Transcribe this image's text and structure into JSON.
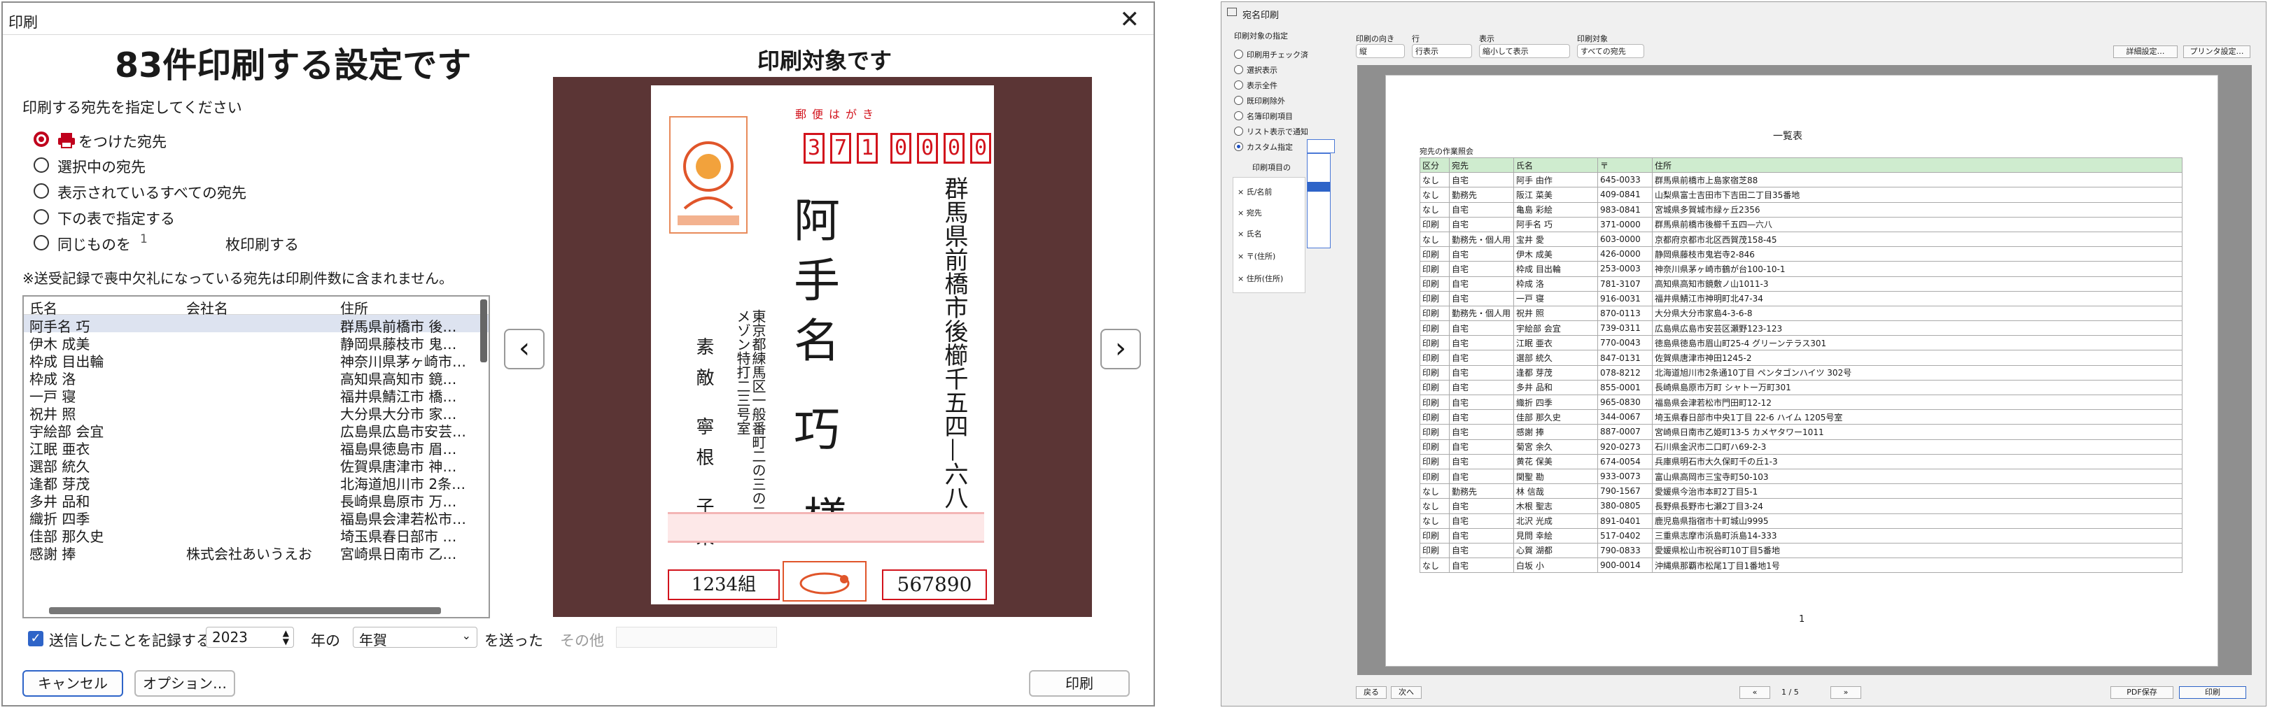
{
  "dialog": {
    "title": "印刷",
    "close_glyph": "✕",
    "heading": "83件印刷する設定です",
    "specify_label": "印刷する宛先を指定してください",
    "options": [
      "をつけた宛先",
      "選択中の宛先",
      "表示されているすべての宛先",
      "下の表で指定する",
      "同じものを"
    ],
    "copies_value": "1",
    "copies_suffix": "枚印刷する",
    "note": "※送受記録で喪中欠礼になっている宛先は印刷件数に含まれません。",
    "columns": [
      "氏名",
      "会社名",
      "住所"
    ],
    "rows": [
      [
        "阿手名 巧",
        "",
        "群馬県前橋市 後…"
      ],
      [
        "伊木 成美",
        "",
        "静岡県藤枝市 鬼…"
      ],
      [
        "枠成 目出輪",
        "",
        "神奈川県茅ヶ崎市…"
      ],
      [
        "枠成 洛",
        "",
        "高知県高知市 鏡…"
      ],
      [
        "一戸 寝",
        "",
        "福井県鯖江市 橋…"
      ],
      [
        "祝井 照",
        "",
        "大分県大分市 家…"
      ],
      [
        "宇絵部 会宜",
        "",
        "広島県広島市安芸…"
      ],
      [
        "江眠 亜衣",
        "",
        "福島県徳島市 眉…"
      ],
      [
        "選部 統久",
        "",
        "佐賀県唐津市 神…"
      ],
      [
        "逢都 芽茂",
        "",
        "北海道旭川市 2条…"
      ],
      [
        "多井 品和",
        "",
        "長崎県島原市 万…"
      ],
      [
        "織折 四季",
        "",
        "福島県会津若松市…"
      ],
      [
        "佳部 那久史",
        "",
        "埼玉県春日部市 …"
      ],
      [
        "感謝 捧",
        "株式会社あいうえお",
        "宮崎県日南市 乙…"
      ]
    ],
    "record_label": "送信したことを記録する",
    "year_value": "2023",
    "year_suffix": "年の",
    "type_value": "年賀",
    "sent_label": "を送った",
    "other_label": "その他",
    "cancel_label": "キャンセル",
    "options_label": "オプション…",
    "print_label": "印刷",
    "preview_title": "印刷対象です",
    "prev_glyph": "‹",
    "next_glyph": "›"
  },
  "postcard": {
    "stamp_label": "郵便はがき",
    "zip_digits": [
      "3",
      "7",
      "1",
      "0",
      "0",
      "0",
      "0"
    ],
    "address": "群馬県前橋市後櫛千五四—六八",
    "recipient": "阿手名 巧",
    "honorific": "様",
    "sender_address": "東京都練馬区一般番町二の三の二 メゾン特打二三号室",
    "sender_name": "素敵 寧根 子来",
    "lottery_group": "1234組",
    "lottery_number": "567890"
  },
  "sub": {
    "title": "宛名印刷",
    "left_label": "印刷対象の指定",
    "left_options": [
      "印刷用チェック済",
      "選択表示",
      "表示全件",
      "既印刷除外",
      "名簿印刷項目",
      "リスト表示で通知",
      "カスタム指定"
    ],
    "item_label": "印刷項目の",
    "items": [
      "氏/名前",
      "宛先",
      "氏名",
      "〒(住所)",
      "住所(住所)"
    ],
    "toolbar_labels": [
      "印刷の向き",
      "行",
      "表示",
      "印刷対象"
    ],
    "toolbar_values": [
      "縦",
      "行表示",
      "縮小して表示",
      "すべての宛先"
    ],
    "btn_settings": "詳細設定…",
    "btn_printer": "プリンタ設定…",
    "page_title": "一覧表",
    "page_subtitle": "宛先の作業照会",
    "cols": [
      "区分",
      "宛先",
      "氏名",
      "〒",
      "住所"
    ],
    "table_rows": [
      [
        "なし",
        "自宅",
        "阿手 由作",
        "645-0033",
        "群馬県前橋市上島家宿芝88"
      ],
      [
        "なし",
        "勤務先",
        "阪江 菜美",
        "409-0841",
        "山梨県富士吉田市下吉田二丁目35番地"
      ],
      [
        "なし",
        "自宅",
        "亀島 彩絵",
        "983-0841",
        "宮城県多賀城市緑ヶ丘2356"
      ],
      [
        "印刷",
        "自宅",
        "阿手名 巧",
        "371-0000",
        "群馬県前橋市後櫛千五四—六八"
      ],
      [
        "なし",
        "勤務先・個人用",
        "宝井 愛",
        "603-0000",
        "京都府京都市北区西賀茂158-45"
      ],
      [
        "印刷",
        "自宅",
        "伊木 成美",
        "426-0000",
        "静岡県藤枝市鬼岩寺2-846"
      ],
      [
        "印刷",
        "自宅",
        "枠成 目出輪",
        "253-0003",
        "神奈川県茅ヶ崎市鶴が台100-10-1"
      ],
      [
        "印刷",
        "自宅",
        "枠成 洛",
        "781-3107",
        "高知県高知市鏡敷ノ山1011-3"
      ],
      [
        "印刷",
        "自宅",
        "一戸 寝",
        "916-0031",
        "福井県鯖江市神明町北47-34"
      ],
      [
        "印刷",
        "勤務先・個人用",
        "祝井 照",
        "870-0113",
        "大分県大分市家島4-3-6-8"
      ],
      [
        "印刷",
        "自宅",
        "宇絵部 会宜",
        "739-0311",
        "広島県広島市安芸区瀬野123-123"
      ],
      [
        "印刷",
        "自宅",
        "江眠 亜衣",
        "770-0043",
        "徳島県徳島市眉山町25-4 グリーンテラス301"
      ],
      [
        "印刷",
        "自宅",
        "選部 統久",
        "847-0131",
        "佐賀県唐津市神田1245-2"
      ],
      [
        "印刷",
        "自宅",
        "逢都 芽茂",
        "078-8212",
        "北海道旭川市2条通10丁目 ペンタゴンハイツ 302号"
      ],
      [
        "印刷",
        "自宅",
        "多井 品和",
        "855-0001",
        "長崎県島原市万町 シャトー万町301"
      ],
      [
        "印刷",
        "自宅",
        "織折 四季",
        "965-0830",
        "福島県会津若松市門田町12-12"
      ],
      [
        "印刷",
        "自宅",
        "佳部 那久史",
        "344-0067",
        "埼玉県春日部市中央1丁目 22-6 ハイム 1205号室"
      ],
      [
        "印刷",
        "自宅",
        "感謝 捧",
        "887-0007",
        "宮崎県日南市乙姫町13-5 カメヤタワー1011"
      ],
      [
        "印刷",
        "自宅",
        "菊宮 余久",
        "920-0273",
        "石川県金沢市二口町ハ69-2-3"
      ],
      [
        "印刷",
        "自宅",
        "黄花 保美",
        "674-0054",
        "兵庫県明石市大久保町千の丘1-3"
      ],
      [
        "印刷",
        "自宅",
        "関聖 勘",
        "933-0073",
        "富山県高岡市三宝寺町50-103"
      ],
      [
        "なし",
        "勤務先",
        "林 信哉",
        "790-1567",
        "愛媛県今治市本町2丁目5-1"
      ],
      [
        "なし",
        "自宅",
        "木根 聖志",
        "380-0805",
        "長野県長野市七瀬2丁目3-24"
      ],
      [
        "なし",
        "自宅",
        "北沢 光成",
        "891-0401",
        "鹿児島県指宿市十町城山9995"
      ],
      [
        "印刷",
        "自宅",
        "見問 幸絵",
        "517-0402",
        "三重県志摩市浜島町浜島14-333"
      ],
      [
        "印刷",
        "自宅",
        "心賀 湖都",
        "790-0833",
        "愛媛県松山市祝谷町10丁目5番地"
      ],
      [
        "なし",
        "自宅",
        "白坂 小",
        "900-0014",
        "沖縄県那覇市松尾1丁目1番地1号"
      ]
    ],
    "page_number": "1",
    "bottom_left": [
      "戻る",
      "次へ"
    ],
    "pager": "1 / 5",
    "first_glyph": "«",
    "last_glyph": "»",
    "bottom_right": [
      "PDF保存",
      "印刷"
    ]
  }
}
